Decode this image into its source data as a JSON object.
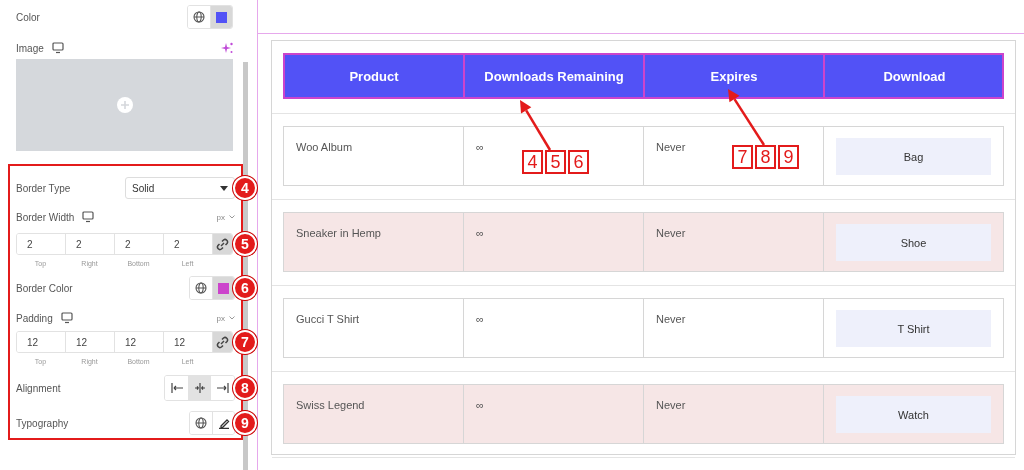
{
  "panel": {
    "color": {
      "label": "Color",
      "color": "#5252f6"
    },
    "image": {
      "label": "Image"
    },
    "border_type": {
      "label": "Border Type",
      "value": "Solid",
      "badge": "4"
    },
    "border_width": {
      "label": "Border Width",
      "unit": "px",
      "values": [
        "2",
        "2",
        "2",
        "2"
      ],
      "sides": [
        "Top",
        "Right",
        "Bottom",
        "Left"
      ],
      "linked": true,
      "badge": "5"
    },
    "border_color": {
      "label": "Border Color",
      "color": "#cc44cc",
      "badge": "6"
    },
    "padding": {
      "label": "Padding",
      "unit": "px",
      "values": [
        "12",
        "12",
        "12",
        "12"
      ],
      "sides": [
        "Top",
        "Right",
        "Bottom",
        "Left"
      ],
      "linked": true,
      "badge": "7"
    },
    "alignment": {
      "label": "Alignment",
      "badge": "8",
      "options": [
        {
          "kind": "start",
          "selected": false
        },
        {
          "kind": "center",
          "selected": true
        },
        {
          "kind": "end",
          "selected": false
        }
      ]
    },
    "typography": {
      "label": "Typography",
      "badge": "9"
    }
  },
  "table": {
    "columns": [
      "Product",
      "Downloads Remaining",
      "Expires",
      "Download"
    ],
    "rows": [
      {
        "product": "Woo Album",
        "downloads": "∞",
        "expires": "Never",
        "button": "Bag"
      },
      {
        "product": "Sneaker in Hemp",
        "downloads": "∞",
        "expires": "Never",
        "button": "Shoe"
      },
      {
        "product": "Gucci T Shirt",
        "downloads": "∞",
        "expires": "Never",
        "button": "T Shirt"
      },
      {
        "product": "Swiss Legend",
        "downloads": "∞",
        "expires": "Never",
        "button": "Watch"
      }
    ]
  },
  "annotations": [
    {
      "digits": [
        "4",
        "5",
        "6"
      ]
    },
    {
      "digits": [
        "7",
        "8",
        "9"
      ]
    }
  ]
}
